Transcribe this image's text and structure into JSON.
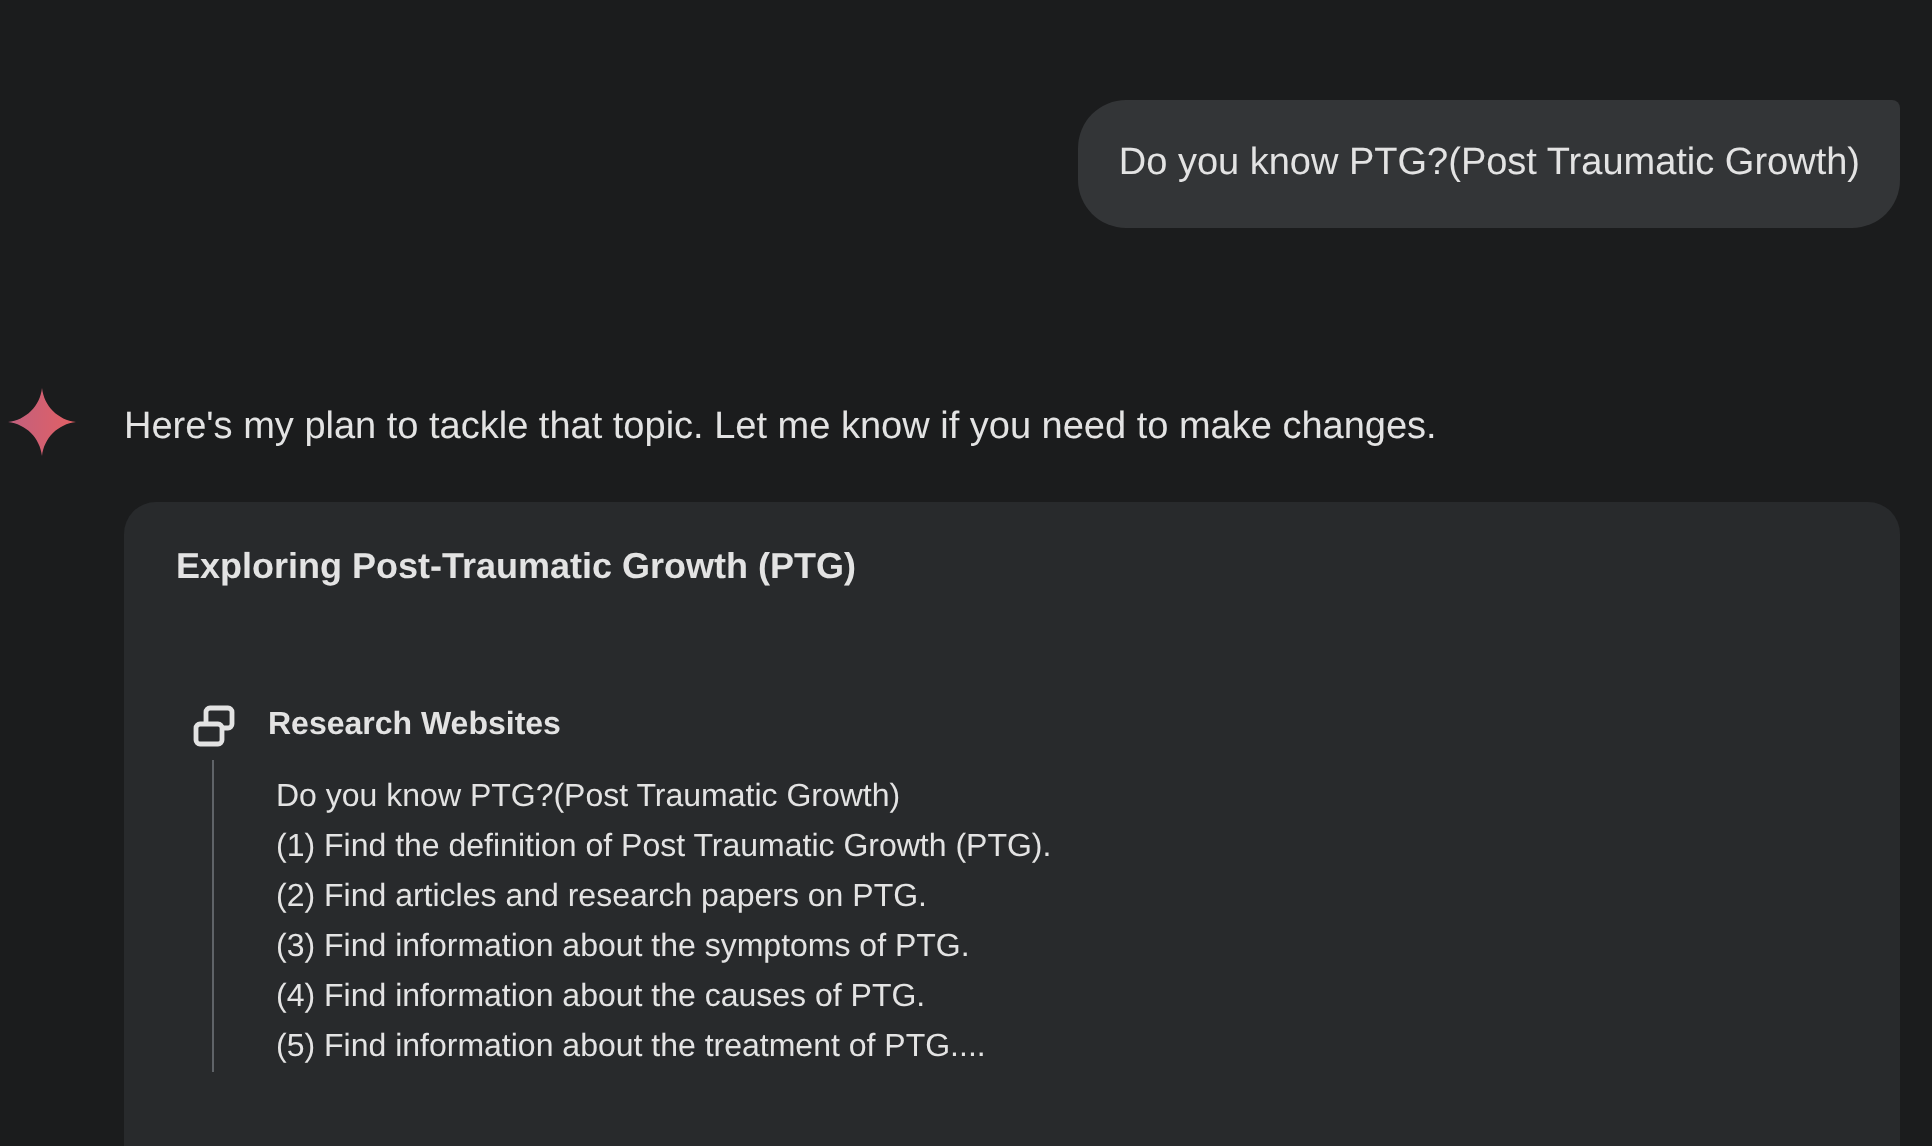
{
  "user_message": {
    "text": "Do you know PTG?(Post Traumatic Growth)"
  },
  "response": {
    "intro": "Here's my plan to tackle that topic. Let me know if you need to make changes.",
    "plan_card": {
      "title": "Exploring Post-Traumatic Growth (PTG)",
      "steps": [
        {
          "kind": "research",
          "label": "Research Websites",
          "lines": [
            "Do you know PTG?(Post Traumatic Growth)",
            "(1) Find the definition of Post Traumatic Growth (PTG).",
            "(2) Find articles and research papers on PTG.",
            "(3) Find information about the symptoms of PTG.",
            "(4) Find information about the causes of PTG.",
            "(5) Find information about the treatment of PTG...."
          ]
        }
      ]
    }
  }
}
